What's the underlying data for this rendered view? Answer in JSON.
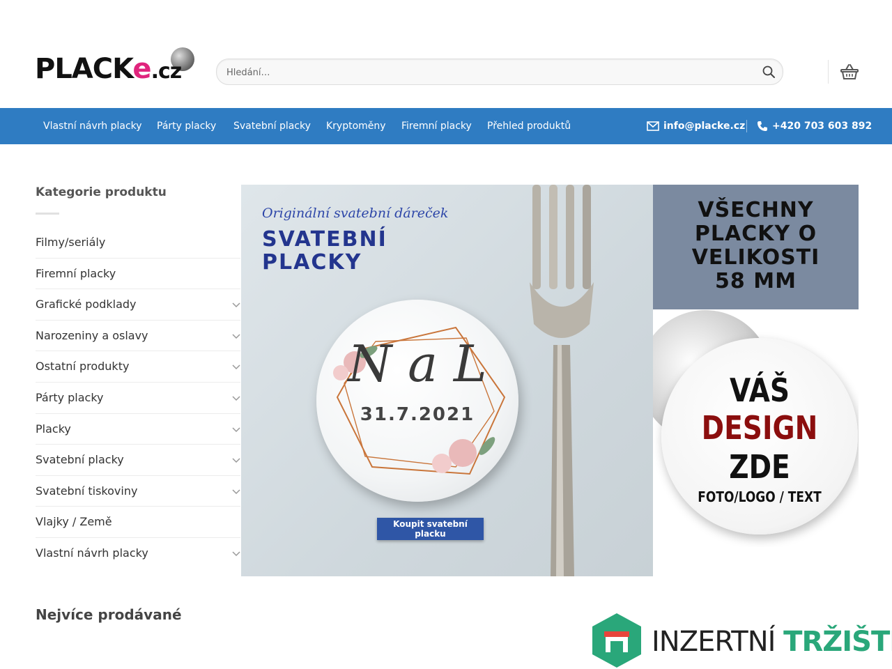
{
  "header": {
    "logo_main": "PLACK",
    "logo_e": "e",
    "logo_tld": ".cz",
    "search": {
      "placeholder": "Hledání…"
    }
  },
  "nav": {
    "items": [
      "Vlastní návrh placky",
      "Párty placky",
      "Svatební placky",
      "Kryptoměny",
      "Firemní placky",
      "Přehled produktů"
    ],
    "email": "info@placke.cz",
    "phone": "+420 703 603 892"
  },
  "sidebar": {
    "title": "Kategorie produktu",
    "categories": [
      {
        "label": "Filmy/seriály",
        "expandable": false
      },
      {
        "label": "Firemní placky",
        "expandable": false
      },
      {
        "label": "Grafické podklady",
        "expandable": true
      },
      {
        "label": "Narozeniny a oslavy",
        "expandable": true
      },
      {
        "label": "Ostatní produkty",
        "expandable": true
      },
      {
        "label": "Párty placky",
        "expandable": true
      },
      {
        "label": "Placky",
        "expandable": true
      },
      {
        "label": "Svatební placky",
        "expandable": true
      },
      {
        "label": "Svatební tiskoviny",
        "expandable": true
      },
      {
        "label": "Vlajky / Země",
        "expandable": false
      },
      {
        "label": "Vlastní návrh placky",
        "expandable": true
      }
    ],
    "bestsellers_title": "Nejvíce prodávané"
  },
  "banner": {
    "subtitle": "Originální svatební dáreček",
    "title_line1": "SVATEBNÍ",
    "title_line2": "PLACKY",
    "badge_initials": "N a L",
    "badge_date": "31.7.2021",
    "button": "Koupit svatební placku"
  },
  "card_size": {
    "line1": "VŠECHNY",
    "line2": "PLACKY O",
    "line3": "VELIKOSTI",
    "line4": "58 MM"
  },
  "card_design": {
    "line1": "VÁŠ",
    "line2": "DESIGN",
    "line3": "ZDE",
    "line4": "FOTO/LOGO / TEXT"
  },
  "watermark": {
    "word1": "INZERTNÍ",
    "word2": "TRŽIŠTĚ"
  },
  "colors": {
    "nav_bg": "#2f7cc2",
    "banner_title": "#23358e",
    "design_accent": "#8b0e0e",
    "watermark_accent": "#2aa77a"
  }
}
